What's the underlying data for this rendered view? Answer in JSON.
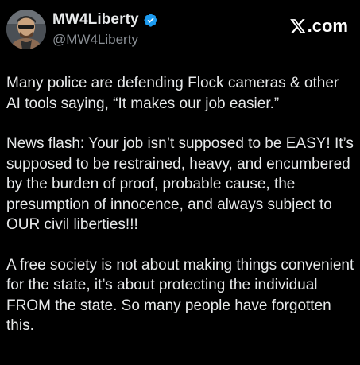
{
  "author": {
    "display_name": "MW4Liberty",
    "handle": "@MW4Liberty",
    "verified": true,
    "avatar_icon": "profile-photo"
  },
  "brand": {
    "label": ".com",
    "icon": "x-logo-icon"
  },
  "post": {
    "paragraphs": [
      "Many police are defending Flock cameras & other AI tools saying, “It makes our job easier.”",
      "News flash:  Your job isn’t supposed to be EASY! It’s supposed to be restrained, heavy, and encumbered by the burden of proof, probable cause, the presumption of innocence, and always subject to OUR civil liberties!!!",
      "A free society is not about making things convenient for the state, it’s about protecting the individual FROM the state. So many people have forgotten this."
    ]
  },
  "colors": {
    "background": "#000000",
    "text": "#e7e9ea",
    "secondary_text": "#8b9096",
    "verified_badge": "#1d9bf0"
  }
}
